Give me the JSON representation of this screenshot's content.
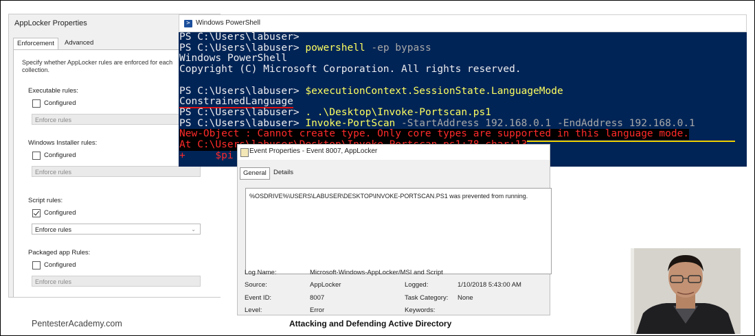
{
  "applocker": {
    "title": "AppLocker Properties",
    "tabs": [
      "Enforcement",
      "Advanced"
    ],
    "description": "Specify whether AppLocker rules are enforced for each\ncollection.",
    "groups": [
      {
        "label": "Executable rules:",
        "configured_label": "Configured",
        "checked": false,
        "select": "Enforce rules",
        "enabled": false
      },
      {
        "label": "Windows Installer rules:",
        "configured_label": "Configured",
        "checked": false,
        "select": "Enforce rules",
        "enabled": false
      },
      {
        "label": "Script rules:",
        "configured_label": "Configured",
        "checked": true,
        "select": "Enforce rules",
        "enabled": true
      },
      {
        "label": "Packaged app Rules:",
        "configured_label": "Configured",
        "checked": false,
        "select": "Enforce rules",
        "enabled": false
      }
    ]
  },
  "powershell": {
    "title": "Windows PowerShell",
    "lines": [
      {
        "prompt": "PS C:\\Users\\labuser>",
        "cmd": "",
        "rest": ""
      },
      {
        "prompt": "PS C:\\Users\\labuser>",
        "cmd": "powershell",
        "rest": " -ep bypass"
      },
      {
        "text": "Windows PowerShell"
      },
      {
        "text": "Copyright (C) Microsoft Corporation. All rights reserved."
      },
      {
        "text": ""
      },
      {
        "prompt": "PS C:\\Users\\labuser>",
        "cmd": "$executionContext.SessionState.LanguageMode",
        "rest": ""
      },
      {
        "text": "ConstrainedLanguage"
      },
      {
        "prompt": "PS C:\\Users\\labuser>",
        "cmd": ". .\\Desktop\\Invoke-Portscan.ps1",
        "rest": ""
      },
      {
        "prompt": "PS C:\\Users\\labuser>",
        "cmd": "Invoke-PortScan",
        "rest": " -StartAddress 192.168.0.1 -EndAddress 192.168.0.1"
      },
      {
        "error": "New-Object : Cannot create type. Only core types are supported in this language mode."
      },
      {
        "error": "At C:\\Users\\labuser\\Desktop\\Invoke-Portscan.ps1:78 char:13"
      },
      {
        "error": "+     $pi"
      }
    ]
  },
  "event": {
    "title": "Event Properties - Event 8007, AppLocker",
    "tabs": [
      "General",
      "Details"
    ],
    "message": "%OSDRIVE%\\USERS\\LABUSER\\DESKTOP\\INVOKE-PORTSCAN.PS1 was prevented from running.",
    "fields": {
      "log_name_label": "Log Name:",
      "log_name": "Microsoft-Windows-AppLocker/MSI and Script",
      "source_label": "Source:",
      "source": "AppLocker",
      "logged_label": "Logged:",
      "logged": "1/10/2018 5:43:00 AM",
      "event_id_label": "Event ID:",
      "event_id": "8007",
      "task_category_label": "Task Category:",
      "task_category": "None",
      "level_label": "Level:",
      "level": "Error",
      "keywords_label": "Keywords:",
      "keywords": ""
    }
  },
  "footer": {
    "site": "PentesterAcademy.com",
    "course": "Attacking and Defending Active Directory"
  },
  "colors": {
    "ps_background": "#012456",
    "ps_command": "#ffff60",
    "ps_error": "#ff2a2a",
    "highlight_underline_red": "#e01010",
    "highlight_underline_yellow": "#f0d000"
  }
}
